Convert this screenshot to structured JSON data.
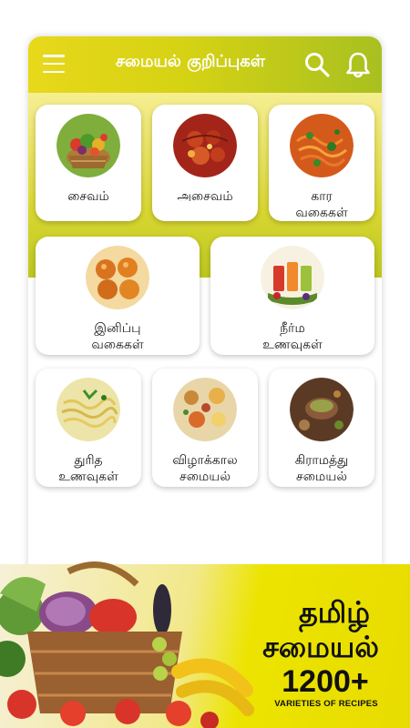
{
  "header": {
    "title": "சமையல் குறிப்புகள்",
    "menu_icon": "hamburger-menu-icon",
    "search_icon": "search-icon",
    "notification_icon": "bell-icon",
    "gradient": [
      "#e8d81a",
      "#a8c020"
    ]
  },
  "categories": [
    {
      "label": "சைவம்",
      "icon": "vegetable-basket-image"
    },
    {
      "label": "அசைவம்",
      "icon": "meat-curry-image"
    },
    {
      "label": "கார\nவகைகள்",
      "icon": "spicy-noodles-image"
    },
    {
      "label": "இனிப்பு\nவகைகள்",
      "icon": "sweets-image"
    },
    {
      "label": "நீர்ம\nஉணவுகள்",
      "icon": "juices-image"
    },
    {
      "label": "துரித\nஉணவுகள்",
      "icon": "noodles-image"
    },
    {
      "label": "விழாக்கால\nசமையல்",
      "icon": "festival-feast-image"
    },
    {
      "label": "கிராமத்து\nசமையல்",
      "icon": "village-cooking-image"
    }
  ],
  "promo": {
    "line1": "தமிழ்",
    "line2": "சமையல்",
    "count": "1200+",
    "subtitle": "VARIETIES OF RECIPES",
    "accent": "#e8dc00"
  }
}
